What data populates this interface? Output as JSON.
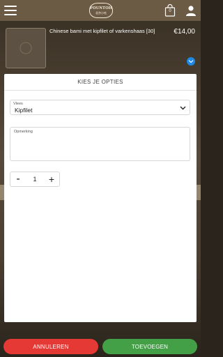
{
  "header": {
    "logo_line1": "POUNTOH",
    "logo_line2": "北京小吃",
    "cart_count": "0"
  },
  "product": {
    "title": "Chinese bami met kipfilet of varkenshaas [30]",
    "price": "€14,00"
  },
  "options_modal": {
    "title": "KIES JE OPTIES",
    "vlees": {
      "label": "Vlees",
      "value": "Kipfilet"
    },
    "opmerking": {
      "label": "Opmerking",
      "value": ""
    },
    "quantity": {
      "minus": "-",
      "value": "1",
      "plus": "+"
    }
  },
  "actions": {
    "cancel_label": "ANNULEREN",
    "add_label": "TOEVOEGEN"
  },
  "colors": {
    "cancel": "#e53935",
    "add": "#43a047",
    "expand": "#1e88e5",
    "topbar": "#6b5a44"
  }
}
